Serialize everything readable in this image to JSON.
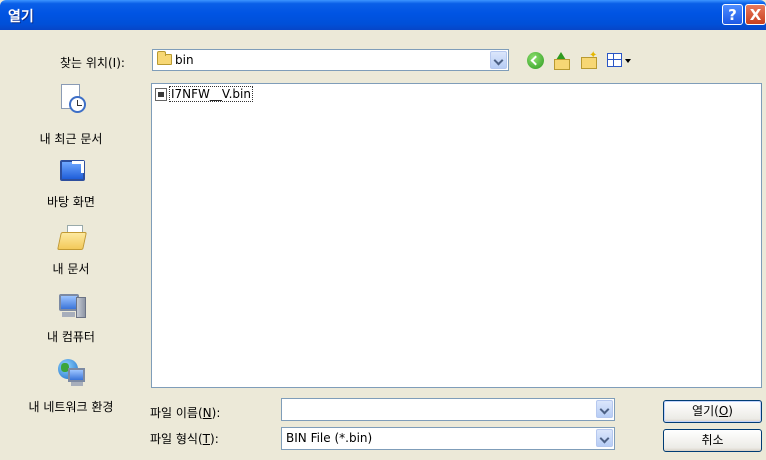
{
  "window": {
    "title": "열기"
  },
  "titlebar": {
    "help_label": "?",
    "close_label": "X"
  },
  "lookin": {
    "label": "찾는 위치(I):",
    "value": "bin"
  },
  "toolbar": {
    "icons": [
      "back-icon",
      "up-folder-icon",
      "new-folder-icon",
      "view-menu-icon"
    ]
  },
  "places": [
    {
      "label": "내 최근 문서",
      "icon": "recent-documents-icon"
    },
    {
      "label": "바탕 화면",
      "icon": "desktop-icon"
    },
    {
      "label": "내 문서",
      "icon": "my-documents-icon"
    },
    {
      "label": "내 컴퓨터",
      "icon": "my-computer-icon"
    },
    {
      "label": "내 네트워크 환경",
      "icon": "network-icon"
    }
  ],
  "files": [
    {
      "name": "I7NFW__V.bin",
      "icon": "bin-file-icon"
    }
  ],
  "filename": {
    "label_prefix": "파일 이름(",
    "label_key": "N",
    "label_suffix": "):",
    "value": ""
  },
  "filetype": {
    "label_prefix": "파일 형식(",
    "label_key": "T",
    "label_suffix": "):",
    "value": "BIN File (*.bin)"
  },
  "buttons": {
    "open_prefix": "열기(",
    "open_key": "O",
    "open_suffix": ")",
    "cancel": "취소"
  }
}
